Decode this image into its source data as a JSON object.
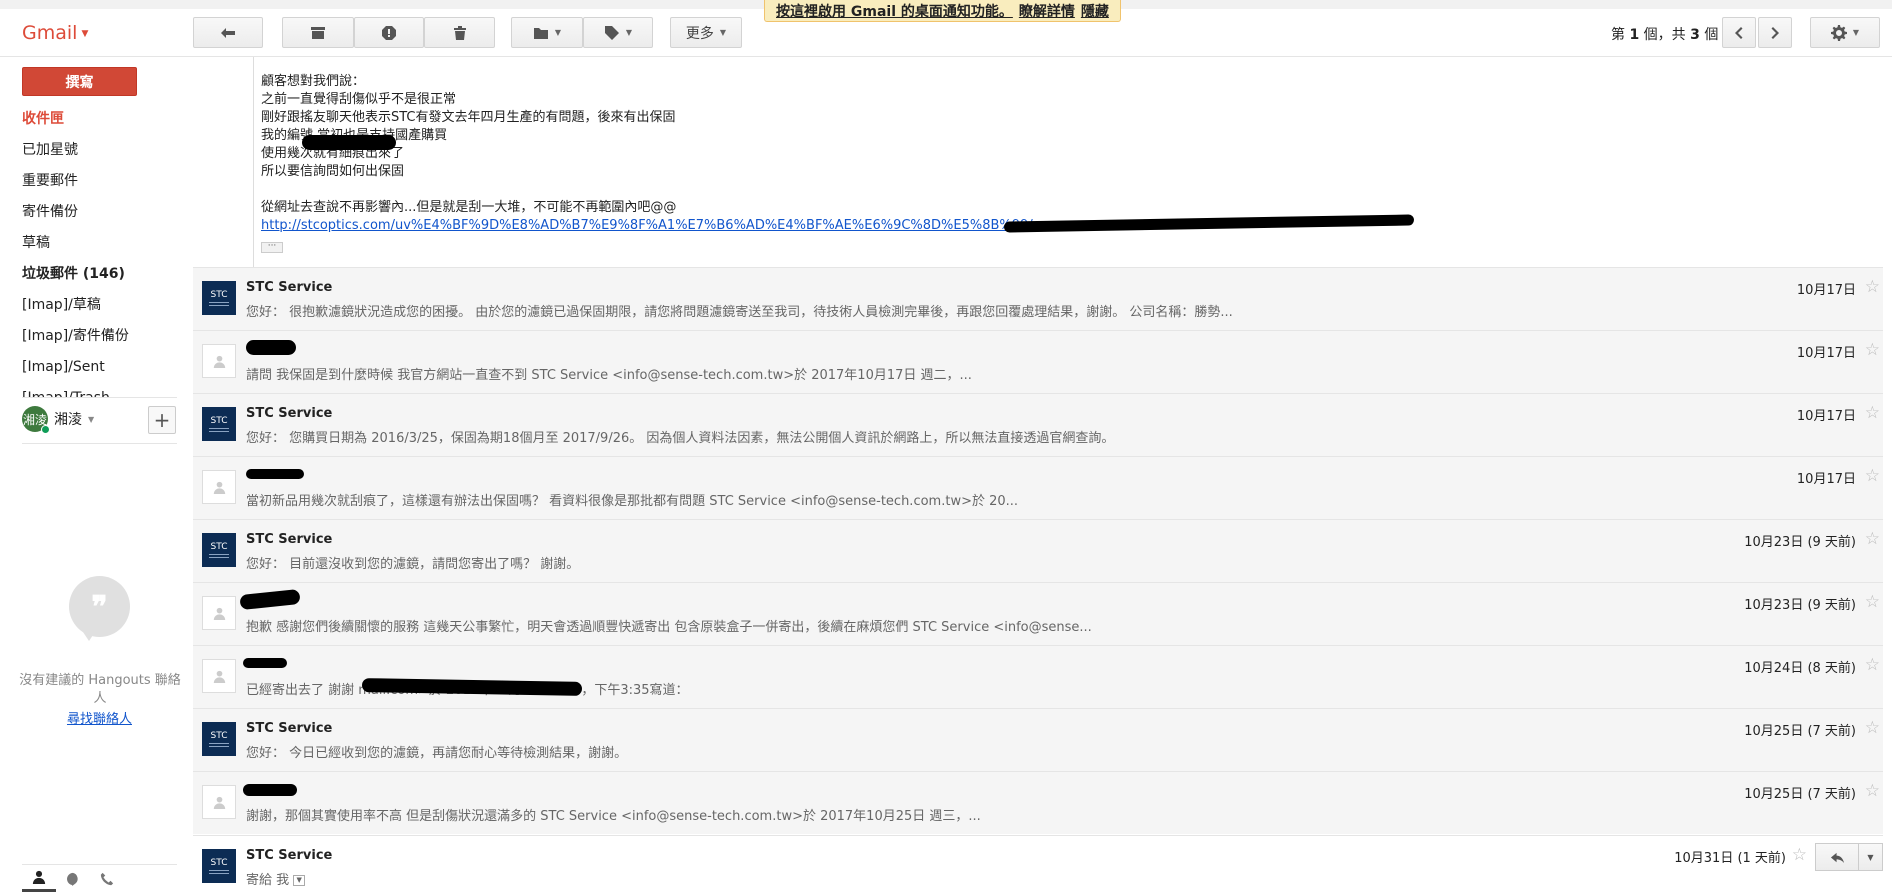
{
  "app": {
    "name": "Gmail"
  },
  "toolbar": {
    "more_label": "更多",
    "pager": {
      "prefix": "第",
      "current": "1",
      "middle": "個，共",
      "total": "3",
      "suffix": "個"
    }
  },
  "notice": {
    "message": "按這裡啟用 Gmail 的桌面通知功能。",
    "learn_more": "瞭解詳情",
    "hide": "隱藏"
  },
  "compose_label": "撰寫",
  "nav": [
    {
      "label": "收件匣"
    },
    {
      "label": "已加星號"
    },
    {
      "label": "重要郵件"
    },
    {
      "label": "寄件備份"
    },
    {
      "label": "草稿"
    },
    {
      "label": "垃圾郵件 (146)"
    },
    {
      "label": "[Imap]/草稿"
    },
    {
      "label": "[Imap]/寄件備份"
    },
    {
      "label": "[Imap]/Sent"
    },
    {
      "label": "[Imap]/Trash"
    }
  ],
  "hangouts": {
    "user_initials": "湘淩",
    "user_name": "湘淩",
    "empty_text": "沒有建議的 Hangouts 聯絡人",
    "find_link": "尋找聯絡人"
  },
  "expanded": {
    "lines": [
      "顧客想對我們說：",
      "之前一直覺得刮傷似乎不是很正常",
      "剛好跟搖友聊天他表示STC有發文去年四月生產的有問題，後來有出保固",
      "我的編號                                         當初也是支持國產購買",
      "使用幾次就有細痕出來了",
      "所以要信詢問如何出保固",
      "",
      "從網址去查說不再影響內...但是就是刮一大堆，不可能不再範圍內吧@@"
    ],
    "link": "http://stcoptics.com/uv%E4%BF%9D%E8%AD%B7%E9%8F%A1%E7%B6%AD%E4%BF%AE%E6%9C%8D%E5%8B%99/..."
  },
  "messages": [
    {
      "sender": "STC Service",
      "stc": true,
      "snippet": "您好： 很抱歉濾鏡狀況造成您的困擾。 由於您的濾鏡已過保固期限，請您將問題濾鏡寄送至我司，待技術人員檢測完畢後，再跟您回覆處理結果，謝謝。 公司名稱：勝勢...",
      "date": "10月17日"
    },
    {
      "sender": "",
      "stc": false,
      "snippet": "請問 我保固是到什麼時候 我官方網站一直查不到 STC Service <info@sense-tech.com.tw>於 2017年10月17日 週二，...",
      "date": "10月17日"
    },
    {
      "sender": "STC Service",
      "stc": true,
      "snippet": "您好： 您購買日期為 2016/3/25，保固為期18個月至 2017/9/26。 因為個人資料法因素，無法公開個人資訊於網路上，所以無法直接透過官網查詢。",
      "date": "10月17日"
    },
    {
      "sender": "",
      "stc": false,
      "snippet": "當初新品用幾次就刮痕了，這樣還有辦法出保固嗎？ 看資料很像是那批都有問題 STC Service <info@sense-tech.com.tw>於 20...",
      "date": "10月17日"
    },
    {
      "sender": "STC Service",
      "stc": true,
      "snippet": "您好： 目前還沒收到您的濾鏡，請問您寄出了嗎？ 謝謝。",
      "date": "10月23日 (9 天前)"
    },
    {
      "sender": "",
      "stc": false,
      "snippet": "抱歉 感謝您們後續關懷的服務 這幾天公事繁忙，明天會透過順豐快遞寄出 包含原裝盒子一併寄出，後續在麻煩您們 STC Service <info@sense...",
      "date": "10月23日 (9 天前)"
    },
    {
      "sender": "",
      "stc": false,
      "snippet": "已經寄出去了 謝謝                                             mail.com>於 2017年10月23日 週一，下午3:35寫道：",
      "date": "10月24日 (8 天前)"
    },
    {
      "sender": "STC Service",
      "stc": true,
      "snippet": "您好： 今日已經收到您的濾鏡，再請您耐心等待檢測結果，謝謝。",
      "date": "10月25日 (7 天前)"
    },
    {
      "sender": "",
      "stc": false,
      "snippet": "謝謝，那個其實使用率不高 但是刮傷狀況還滿多的 STC Service <info@sense-tech.com.tw>於 2017年10月25日 週三，...",
      "date": "10月25日 (7 天前)"
    }
  ],
  "last_message": {
    "sender": "STC Service",
    "to": "寄給 我",
    "date": "10月31日 (1 天前)"
  },
  "stc_logo_text": "STC"
}
